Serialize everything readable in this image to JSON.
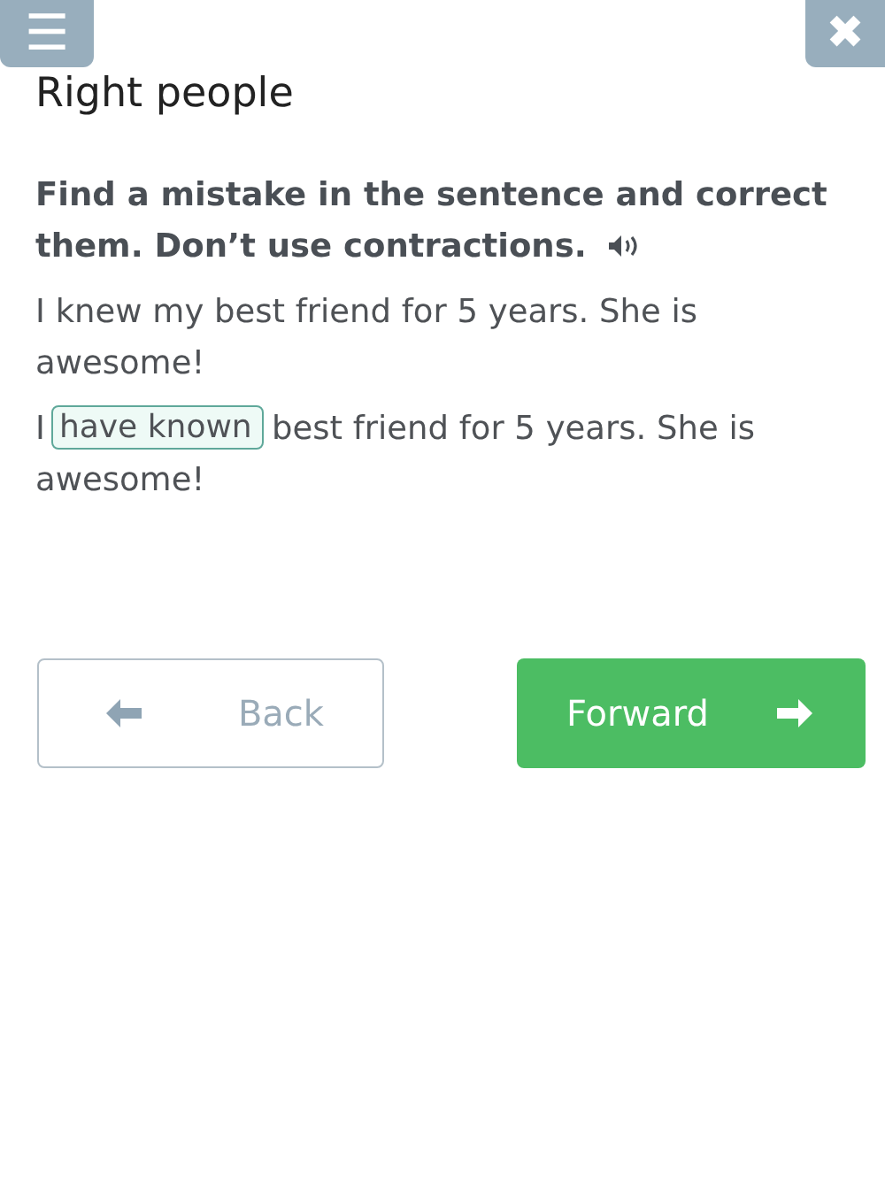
{
  "top_bar": {
    "menu_button": "☰",
    "close_button": "✖"
  },
  "title": "Right people",
  "instruction": [
    "Find a mistake in the sentence and correct",
    "them. Don’t use contractions."
  ],
  "original_sentence": "I knew my best friend for 5 years. She is awesome!",
  "answer": {
    "before": "I",
    "value": "have known",
    "after": [
      "best friend for 5 years. She is",
      "awesome!"
    ]
  },
  "buttons": [
    {
      "kind": "back",
      "label": "Back"
    },
    {
      "kind": "forward",
      "label": "Forward"
    }
  ]
}
